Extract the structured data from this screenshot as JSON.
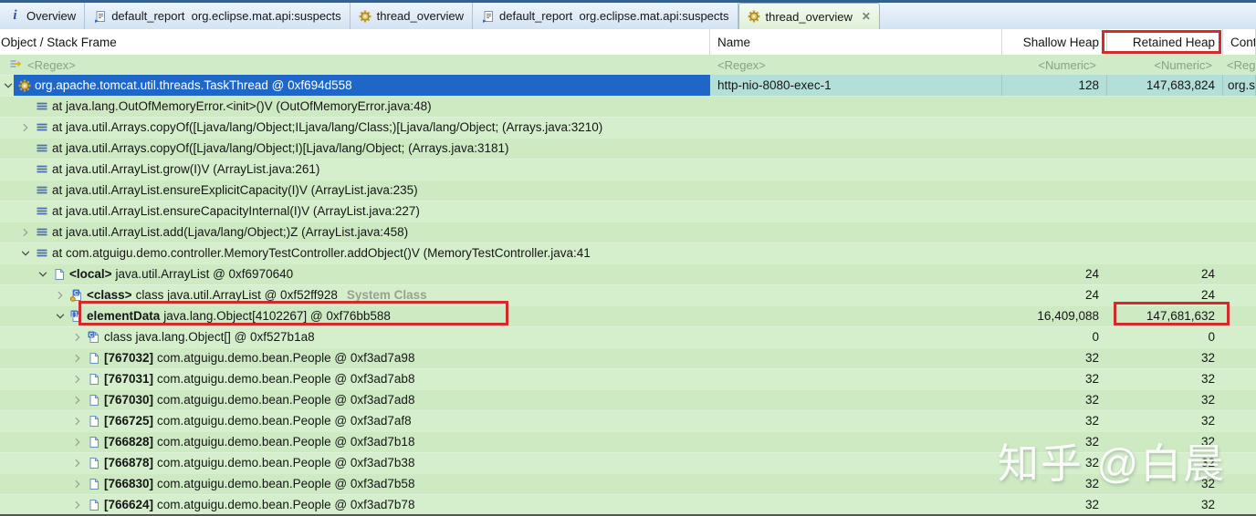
{
  "tabs": [
    {
      "label": "Overview",
      "icon": "overview-icon",
      "active": false,
      "closable": false
    },
    {
      "label": "default_report  org.eclipse.mat.api:suspects",
      "icon": "report-icon",
      "active": false,
      "closable": false
    },
    {
      "label": "thread_overview",
      "icon": "gear-icon",
      "active": false,
      "closable": false
    },
    {
      "label": "default_report  org.eclipse.mat.api:suspects",
      "icon": "report-icon",
      "active": false,
      "closable": false
    },
    {
      "label": "thread_overview",
      "icon": "gear-icon",
      "active": true,
      "closable": true,
      "close_glyph": "☒"
    }
  ],
  "columns": {
    "object": "Object / Stack Frame",
    "name": "Name",
    "shallow": "Shallow Heap",
    "retained": "Retained Heap",
    "context": "Cont"
  },
  "filters": {
    "object": "<Regex>",
    "name": "<Regex>",
    "shallow": "<Numeric>",
    "retained": "<Numeric>",
    "context": "<Reg"
  },
  "tree_rows": [
    {
      "level": 0,
      "expander": "expanded",
      "icon": "thread-icon",
      "bold": "",
      "text": "org.apache.tomcat.util.threads.TaskThread @ 0xf694d558",
      "suffix": "",
      "name": "http-nio-8080-exec-1",
      "shallow": "128",
      "retained": "147,683,824",
      "context": "org.s",
      "selected": true
    },
    {
      "level": 1,
      "expander": "none",
      "icon": "stack-frame-icon",
      "bold": "",
      "text": "at java.lang.OutOfMemoryError.<init>()V (OutOfMemoryError.java:48)",
      "suffix": "",
      "name": "",
      "shallow": "",
      "retained": "",
      "context": ""
    },
    {
      "level": 1,
      "expander": "collapsed",
      "icon": "stack-frame-icon",
      "bold": "",
      "text": "at java.util.Arrays.copyOf([Ljava/lang/Object;ILjava/lang/Class;)[Ljava/lang/Object; (Arrays.java:3210)",
      "suffix": "",
      "name": "",
      "shallow": "",
      "retained": "",
      "context": ""
    },
    {
      "level": 1,
      "expander": "none",
      "icon": "stack-frame-icon",
      "bold": "",
      "text": "at java.util.Arrays.copyOf([Ljava/lang/Object;I)[Ljava/lang/Object; (Arrays.java:3181)",
      "suffix": "",
      "name": "",
      "shallow": "",
      "retained": "",
      "context": ""
    },
    {
      "level": 1,
      "expander": "none",
      "icon": "stack-frame-icon",
      "bold": "",
      "text": "at java.util.ArrayList.grow(I)V (ArrayList.java:261)",
      "suffix": "",
      "name": "",
      "shallow": "",
      "retained": "",
      "context": ""
    },
    {
      "level": 1,
      "expander": "none",
      "icon": "stack-frame-icon",
      "bold": "",
      "text": "at java.util.ArrayList.ensureExplicitCapacity(I)V (ArrayList.java:235)",
      "suffix": "",
      "name": "",
      "shallow": "",
      "retained": "",
      "context": ""
    },
    {
      "level": 1,
      "expander": "none",
      "icon": "stack-frame-icon",
      "bold": "",
      "text": "at java.util.ArrayList.ensureCapacityInternal(I)V (ArrayList.java:227)",
      "suffix": "",
      "name": "",
      "shallow": "",
      "retained": "",
      "context": ""
    },
    {
      "level": 1,
      "expander": "collapsed",
      "icon": "stack-frame-icon",
      "bold": "",
      "text": "at java.util.ArrayList.add(Ljava/lang/Object;)Z (ArrayList.java:458)",
      "suffix": "",
      "name": "",
      "shallow": "",
      "retained": "",
      "context": ""
    },
    {
      "level": 1,
      "expander": "expanded",
      "icon": "stack-frame-icon",
      "bold": "",
      "text": "at com.atguigu.demo.controller.MemoryTestController.addObject()V (MemoryTestController.java:41",
      "suffix": "",
      "name": "",
      "shallow": "",
      "retained": "",
      "context": ""
    },
    {
      "level": 2,
      "expander": "expanded",
      "icon": "object-icon",
      "bold": "<local>",
      "text": "java.util.ArrayList @ 0xf6970640",
      "suffix": "",
      "name": "",
      "shallow": "24",
      "retained": "24",
      "context": ""
    },
    {
      "level": 3,
      "expander": "collapsed",
      "icon": "class-system-icon",
      "bold": "<class>",
      "text": "class java.util.ArrayList @ 0xf52ff928",
      "suffix": "System Class",
      "name": "",
      "shallow": "24",
      "retained": "24",
      "context": ""
    },
    {
      "level": 3,
      "expander": "expanded",
      "icon": "array-icon",
      "bold": "elementData",
      "text": "java.lang.Object[4102267] @ 0xf76bb588",
      "suffix": "",
      "name": "",
      "shallow": "16,409,088",
      "retained": "147,681,632",
      "context": ""
    },
    {
      "level": 4,
      "expander": "collapsed",
      "icon": "class-icon",
      "bold": "",
      "text": "class java.lang.Object[] @ 0xf527b1a8",
      "suffix": "",
      "name": "",
      "shallow": "0",
      "retained": "0",
      "context": ""
    },
    {
      "level": 4,
      "expander": "collapsed",
      "icon": "object-icon",
      "bold": "[767032]",
      "text": "com.atguigu.demo.bean.People @ 0xf3ad7a98",
      "suffix": "",
      "name": "",
      "shallow": "32",
      "retained": "32",
      "context": ""
    },
    {
      "level": 4,
      "expander": "collapsed",
      "icon": "object-icon",
      "bold": "[767031]",
      "text": "com.atguigu.demo.bean.People @ 0xf3ad7ab8",
      "suffix": "",
      "name": "",
      "shallow": "32",
      "retained": "32",
      "context": ""
    },
    {
      "level": 4,
      "expander": "collapsed",
      "icon": "object-icon",
      "bold": "[767030]",
      "text": "com.atguigu.demo.bean.People @ 0xf3ad7ad8",
      "suffix": "",
      "name": "",
      "shallow": "32",
      "retained": "32",
      "context": ""
    },
    {
      "level": 4,
      "expander": "collapsed",
      "icon": "object-icon",
      "bold": "[766725]",
      "text": "com.atguigu.demo.bean.People @ 0xf3ad7af8",
      "suffix": "",
      "name": "",
      "shallow": "32",
      "retained": "32",
      "context": ""
    },
    {
      "level": 4,
      "expander": "collapsed",
      "icon": "object-icon",
      "bold": "[766828]",
      "text": "com.atguigu.demo.bean.People @ 0xf3ad7b18",
      "suffix": "",
      "name": "",
      "shallow": "32",
      "retained": "32",
      "context": ""
    },
    {
      "level": 4,
      "expander": "collapsed",
      "icon": "object-icon",
      "bold": "[766878]",
      "text": "com.atguigu.demo.bean.People @ 0xf3ad7b38",
      "suffix": "",
      "name": "",
      "shallow": "32",
      "retained": "32",
      "context": ""
    },
    {
      "level": 4,
      "expander": "collapsed",
      "icon": "object-icon",
      "bold": "[766830]",
      "text": "com.atguigu.demo.bean.People @ 0xf3ad7b58",
      "suffix": "",
      "name": "",
      "shallow": "32",
      "retained": "32",
      "context": ""
    },
    {
      "level": 4,
      "expander": "collapsed",
      "icon": "object-icon",
      "bold": "[766624]",
      "text": "com.atguigu.demo.bean.People @ 0xf3ad7b78",
      "suffix": "",
      "name": "",
      "shallow": "32",
      "retained": "32",
      "context": ""
    }
  ],
  "watermark": "知乎 @白晨",
  "colors": {
    "selection_blue": "#1e67c8",
    "selected_row_teal": "#b4dfd9",
    "row_green": "#d5efcc",
    "row_green_alt": "#cdeac3",
    "annotation_red": "#d22b2b",
    "active_tab_green": "#dff0d8"
  }
}
